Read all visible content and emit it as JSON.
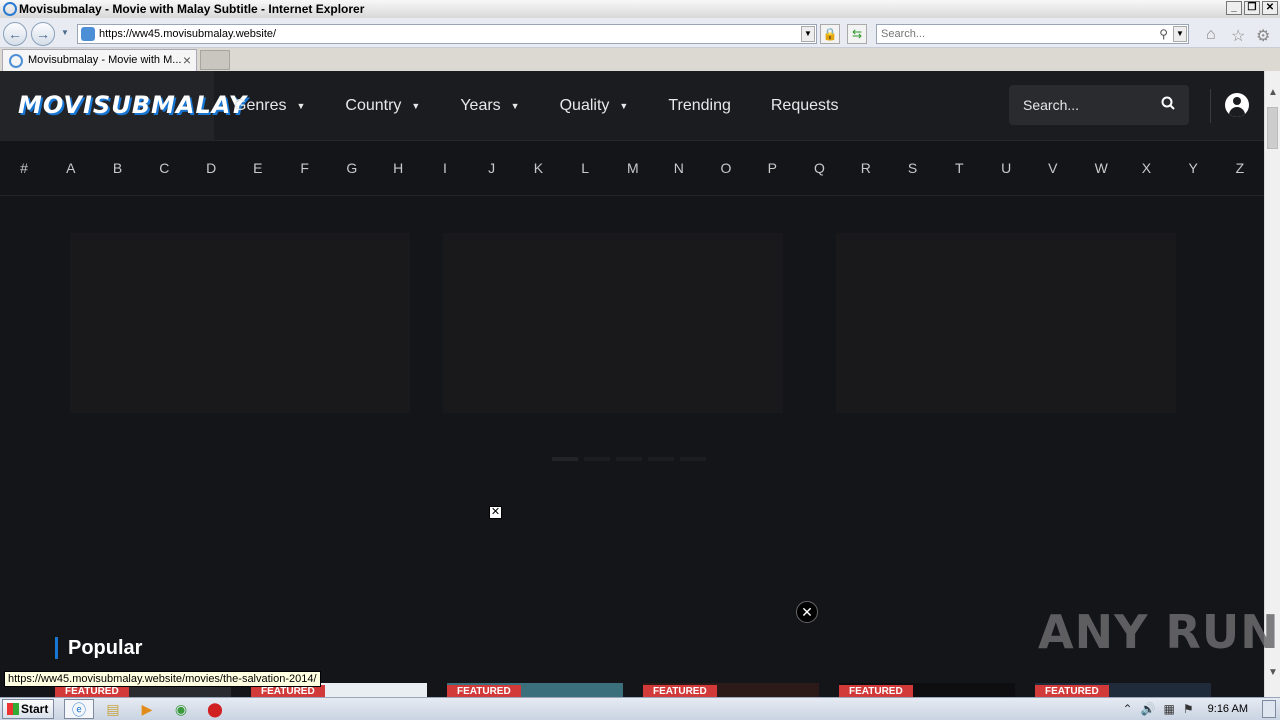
{
  "browser": {
    "window_title": "Movisubmalay - Movie with Malay Subtitle - Internet Explorer",
    "url": "https://ww45.movisubmalay.website/",
    "search_placeholder": "Search...",
    "tab_label": "Movisubmalay - Movie with M...",
    "status_url": "https://ww45.movisubmalay.website/movies/the-salvation-2014/"
  },
  "site": {
    "logo": "MOVISUBMALAY",
    "menu": [
      {
        "label": "Genres"
      },
      {
        "label": "Country"
      },
      {
        "label": "Years"
      },
      {
        "label": "Quality"
      },
      {
        "label": "Trending"
      },
      {
        "label": "Requests"
      }
    ],
    "search_placeholder": "Search...",
    "az": [
      "#",
      "A",
      "B",
      "C",
      "D",
      "E",
      "F",
      "G",
      "H",
      "I",
      "J",
      "K",
      "L",
      "M",
      "N",
      "O",
      "P",
      "Q",
      "R",
      "S",
      "T",
      "U",
      "V",
      "W",
      "X",
      "Y",
      "Z"
    ],
    "section_title": "Popular",
    "card_badge": "FEATURED"
  },
  "watermark": "ANY RUN",
  "taskbar": {
    "start_label": "Start",
    "clock": "9:16 AM"
  },
  "colors": {
    "accent": "#1877d4",
    "page_bg": "#141519",
    "header_bg": "#1b1c20",
    "badge": "#d23a3a"
  }
}
